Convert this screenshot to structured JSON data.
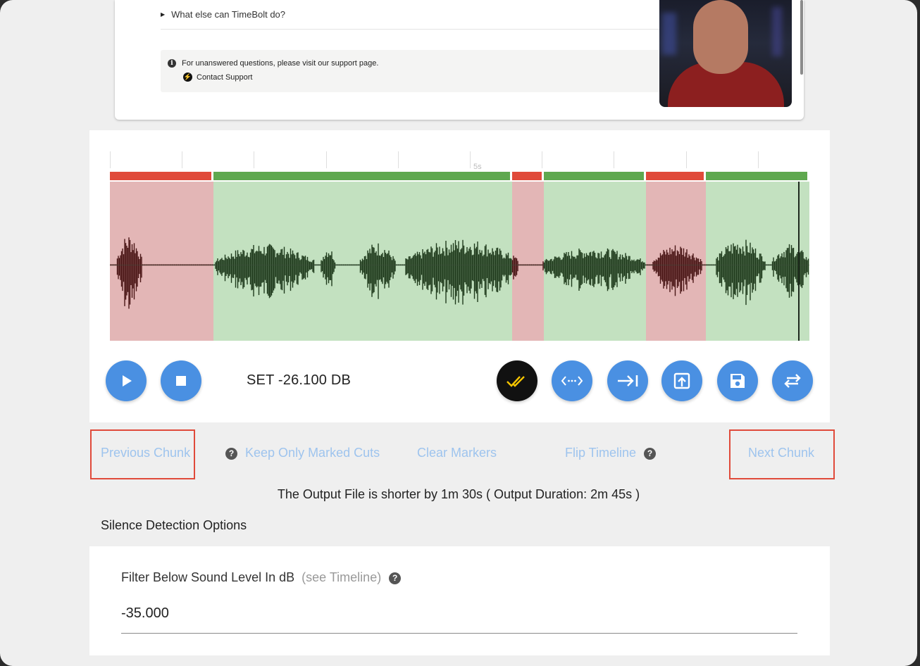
{
  "faq": {
    "item_label": "What else can TimeBolt do?"
  },
  "support": {
    "message": "For unanswered questions, please visit our support page.",
    "contact_label": "Contact Support"
  },
  "timeline": {
    "tick_label": "5s",
    "segments": [
      {
        "type": "cut",
        "start": 0.0,
        "end": 0.148
      },
      {
        "type": "keep",
        "start": 0.148,
        "end": 0.575
      },
      {
        "type": "cut",
        "start": 0.575,
        "end": 0.62
      },
      {
        "type": "keep",
        "start": 0.62,
        "end": 0.766
      },
      {
        "type": "cut",
        "start": 0.766,
        "end": 0.852
      },
      {
        "type": "keep",
        "start": 0.852,
        "end": 1.0
      }
    ],
    "playhead_fraction": 0.984,
    "colors": {
      "cut_bar": "#e04a3a",
      "keep_bar": "#5fa84f",
      "cut_fill": "#e3b6b6",
      "keep_fill": "#c3e1c0",
      "wave_keep": "#1f3a1c",
      "wave_cut": "#4a1616"
    }
  },
  "controls": {
    "set_label": "SET -26.100 DB",
    "icons": [
      "play-icon",
      "stop-icon",
      "double-check-icon",
      "expand-horizontal-icon",
      "skip-to-end-icon",
      "export-icon",
      "save-icon",
      "swap-icon"
    ]
  },
  "links": {
    "previous_chunk": "Previous Chunk",
    "keep_only_marked_cuts": "Keep Only Marked Cuts",
    "clear_markers": "Clear Markers",
    "flip_timeline": "Flip Timeline",
    "next_chunk": "Next Chunk",
    "help_glyph": "?"
  },
  "output_summary": "The Output File is shorter by 1m 30s ( Output Duration: 2m 45s )",
  "silence_section": {
    "title": "Silence Detection Options",
    "filter_label": "Filter Below Sound Level In dB",
    "filter_hint": "(see Timeline)",
    "filter_value": "-35.000"
  },
  "accent_color": "#4a90e2",
  "link_color": "#9ec4ee"
}
